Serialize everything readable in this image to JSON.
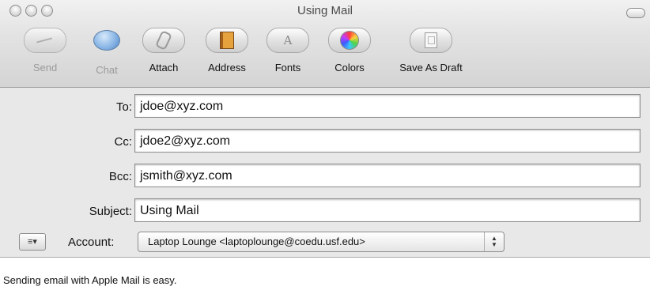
{
  "window": {
    "title": "Using Mail"
  },
  "toolbar": {
    "items": [
      {
        "label": "Send",
        "icon": "send-icon",
        "enabled": false
      },
      {
        "label": "Chat",
        "icon": "chat-icon",
        "enabled": false
      },
      {
        "label": "Attach",
        "icon": "paperclip-icon",
        "enabled": true
      },
      {
        "label": "Address",
        "icon": "address-book-icon",
        "enabled": true
      },
      {
        "label": "Fonts",
        "icon": "fonts-icon",
        "enabled": true
      },
      {
        "label": "Colors",
        "icon": "color-wheel-icon",
        "enabled": true
      },
      {
        "label": "Save As Draft",
        "icon": "draft-document-icon",
        "enabled": true
      }
    ]
  },
  "header": {
    "to": {
      "label": "To:",
      "value": "jdoe@xyz.com"
    },
    "cc": {
      "label": "Cc:",
      "value": "jdoe2@xyz.com"
    },
    "bcc": {
      "label": "Bcc:",
      "value": "jsmith@xyz.com"
    },
    "subject": {
      "label": "Subject:",
      "value": "Using Mail"
    },
    "account": {
      "menu_glyph": "≡▾",
      "label": "Account:",
      "selected": "Laptop Lounge <laptoplounge@coedu.usf.edu>"
    }
  },
  "body": {
    "text": "Sending email with Apple Mail is easy."
  }
}
